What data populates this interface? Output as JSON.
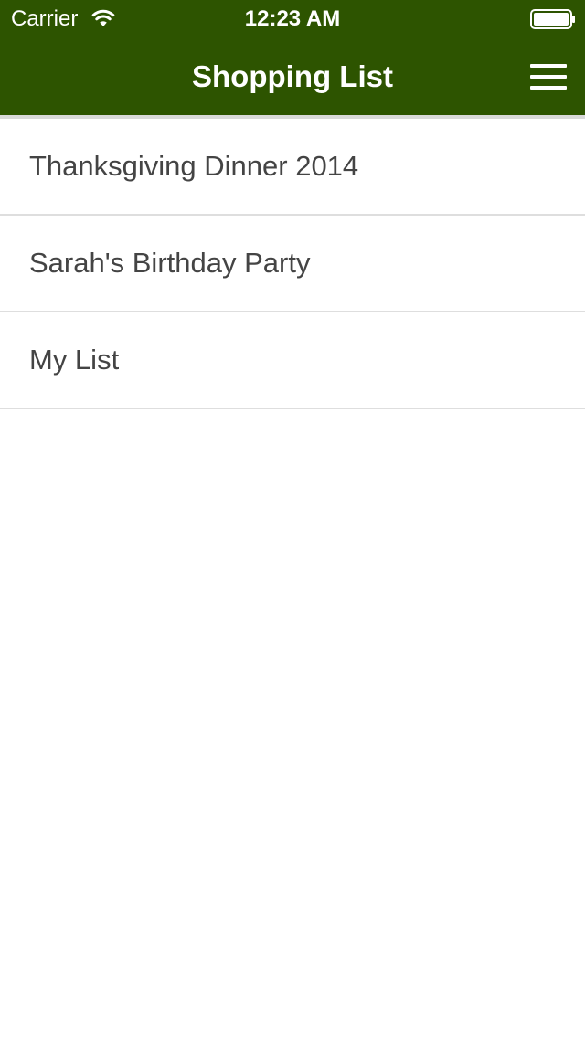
{
  "status_bar": {
    "carrier": "Carrier",
    "time": "12:23 AM",
    "wifi_icon": "wifi-icon",
    "battery_icon": "battery-icon"
  },
  "nav": {
    "title": "Shopping List",
    "menu_icon": "hamburger-menu-icon",
    "bar_color": "#2d5400"
  },
  "lists": {
    "items": [
      {
        "label": "Thanksgiving Dinner 2014"
      },
      {
        "label": "Sarah's Birthday Party"
      },
      {
        "label": "My List"
      }
    ]
  }
}
